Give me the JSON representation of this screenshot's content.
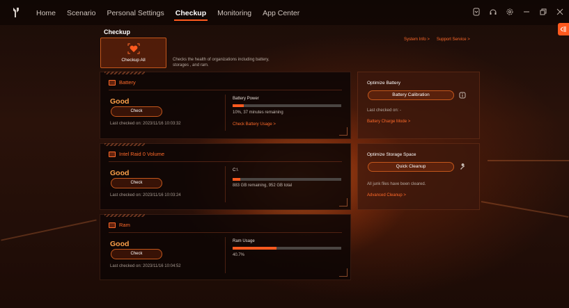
{
  "nav": {
    "items": [
      "Home",
      "Scenario",
      "Personal Settings",
      "Checkup",
      "Monitoring",
      "App Center"
    ],
    "active_index": 3
  },
  "top_icons": [
    "battery-status-icon",
    "headset-icon",
    "settings-icon",
    "minimize-icon",
    "restore-icon",
    "close-icon"
  ],
  "page": {
    "title": "Checkup",
    "checkup_all_label": "Checkup All",
    "description": "Checks the health of organizations including battery, storages , and ram.",
    "links": [
      "System Info >",
      "Support Service >"
    ]
  },
  "cards": [
    {
      "title": "Battery",
      "status": "Good",
      "check_label": "Check",
      "last_checked": "Last checked on: 2023/11/16 10:03:32",
      "metric_title": "Battery Power",
      "progress": 0.1,
      "metric_sub": "10%, 37 minutes remaining",
      "metric_link": "Check Battery Usage >"
    },
    {
      "title": "Intel Raid 0 Volume",
      "status": "Good",
      "check_label": "Check",
      "last_checked": "Last checked on: 2023/11/16 10:03:24",
      "metric_title": "C:\\",
      "progress": 0.072,
      "metric_sub": "883 GB remaining, 952 GB total",
      "metric_link": ""
    },
    {
      "title": "Ram",
      "status": "Good",
      "check_label": "Check",
      "last_checked": "Last checked on: 2023/11/16 10:04:52",
      "metric_title": "Ram Usage",
      "progress": 0.407,
      "metric_sub": "40.7%",
      "metric_link": ""
    }
  ],
  "right": {
    "battery": {
      "title": "Optimize Battery",
      "button": "Battery Calibration",
      "text": "Last checked on: -",
      "link": "Battery Charge Mode >"
    },
    "storage": {
      "title": "Optimize Storage Space",
      "button": "Quick Cleanup",
      "text": "All junk files have been cleared.",
      "link": "Advanced Cleanup >"
    }
  },
  "colors": {
    "accent": "#ff5a1f",
    "status_good": "#ffa24a",
    "link": "#ff6a2a"
  }
}
